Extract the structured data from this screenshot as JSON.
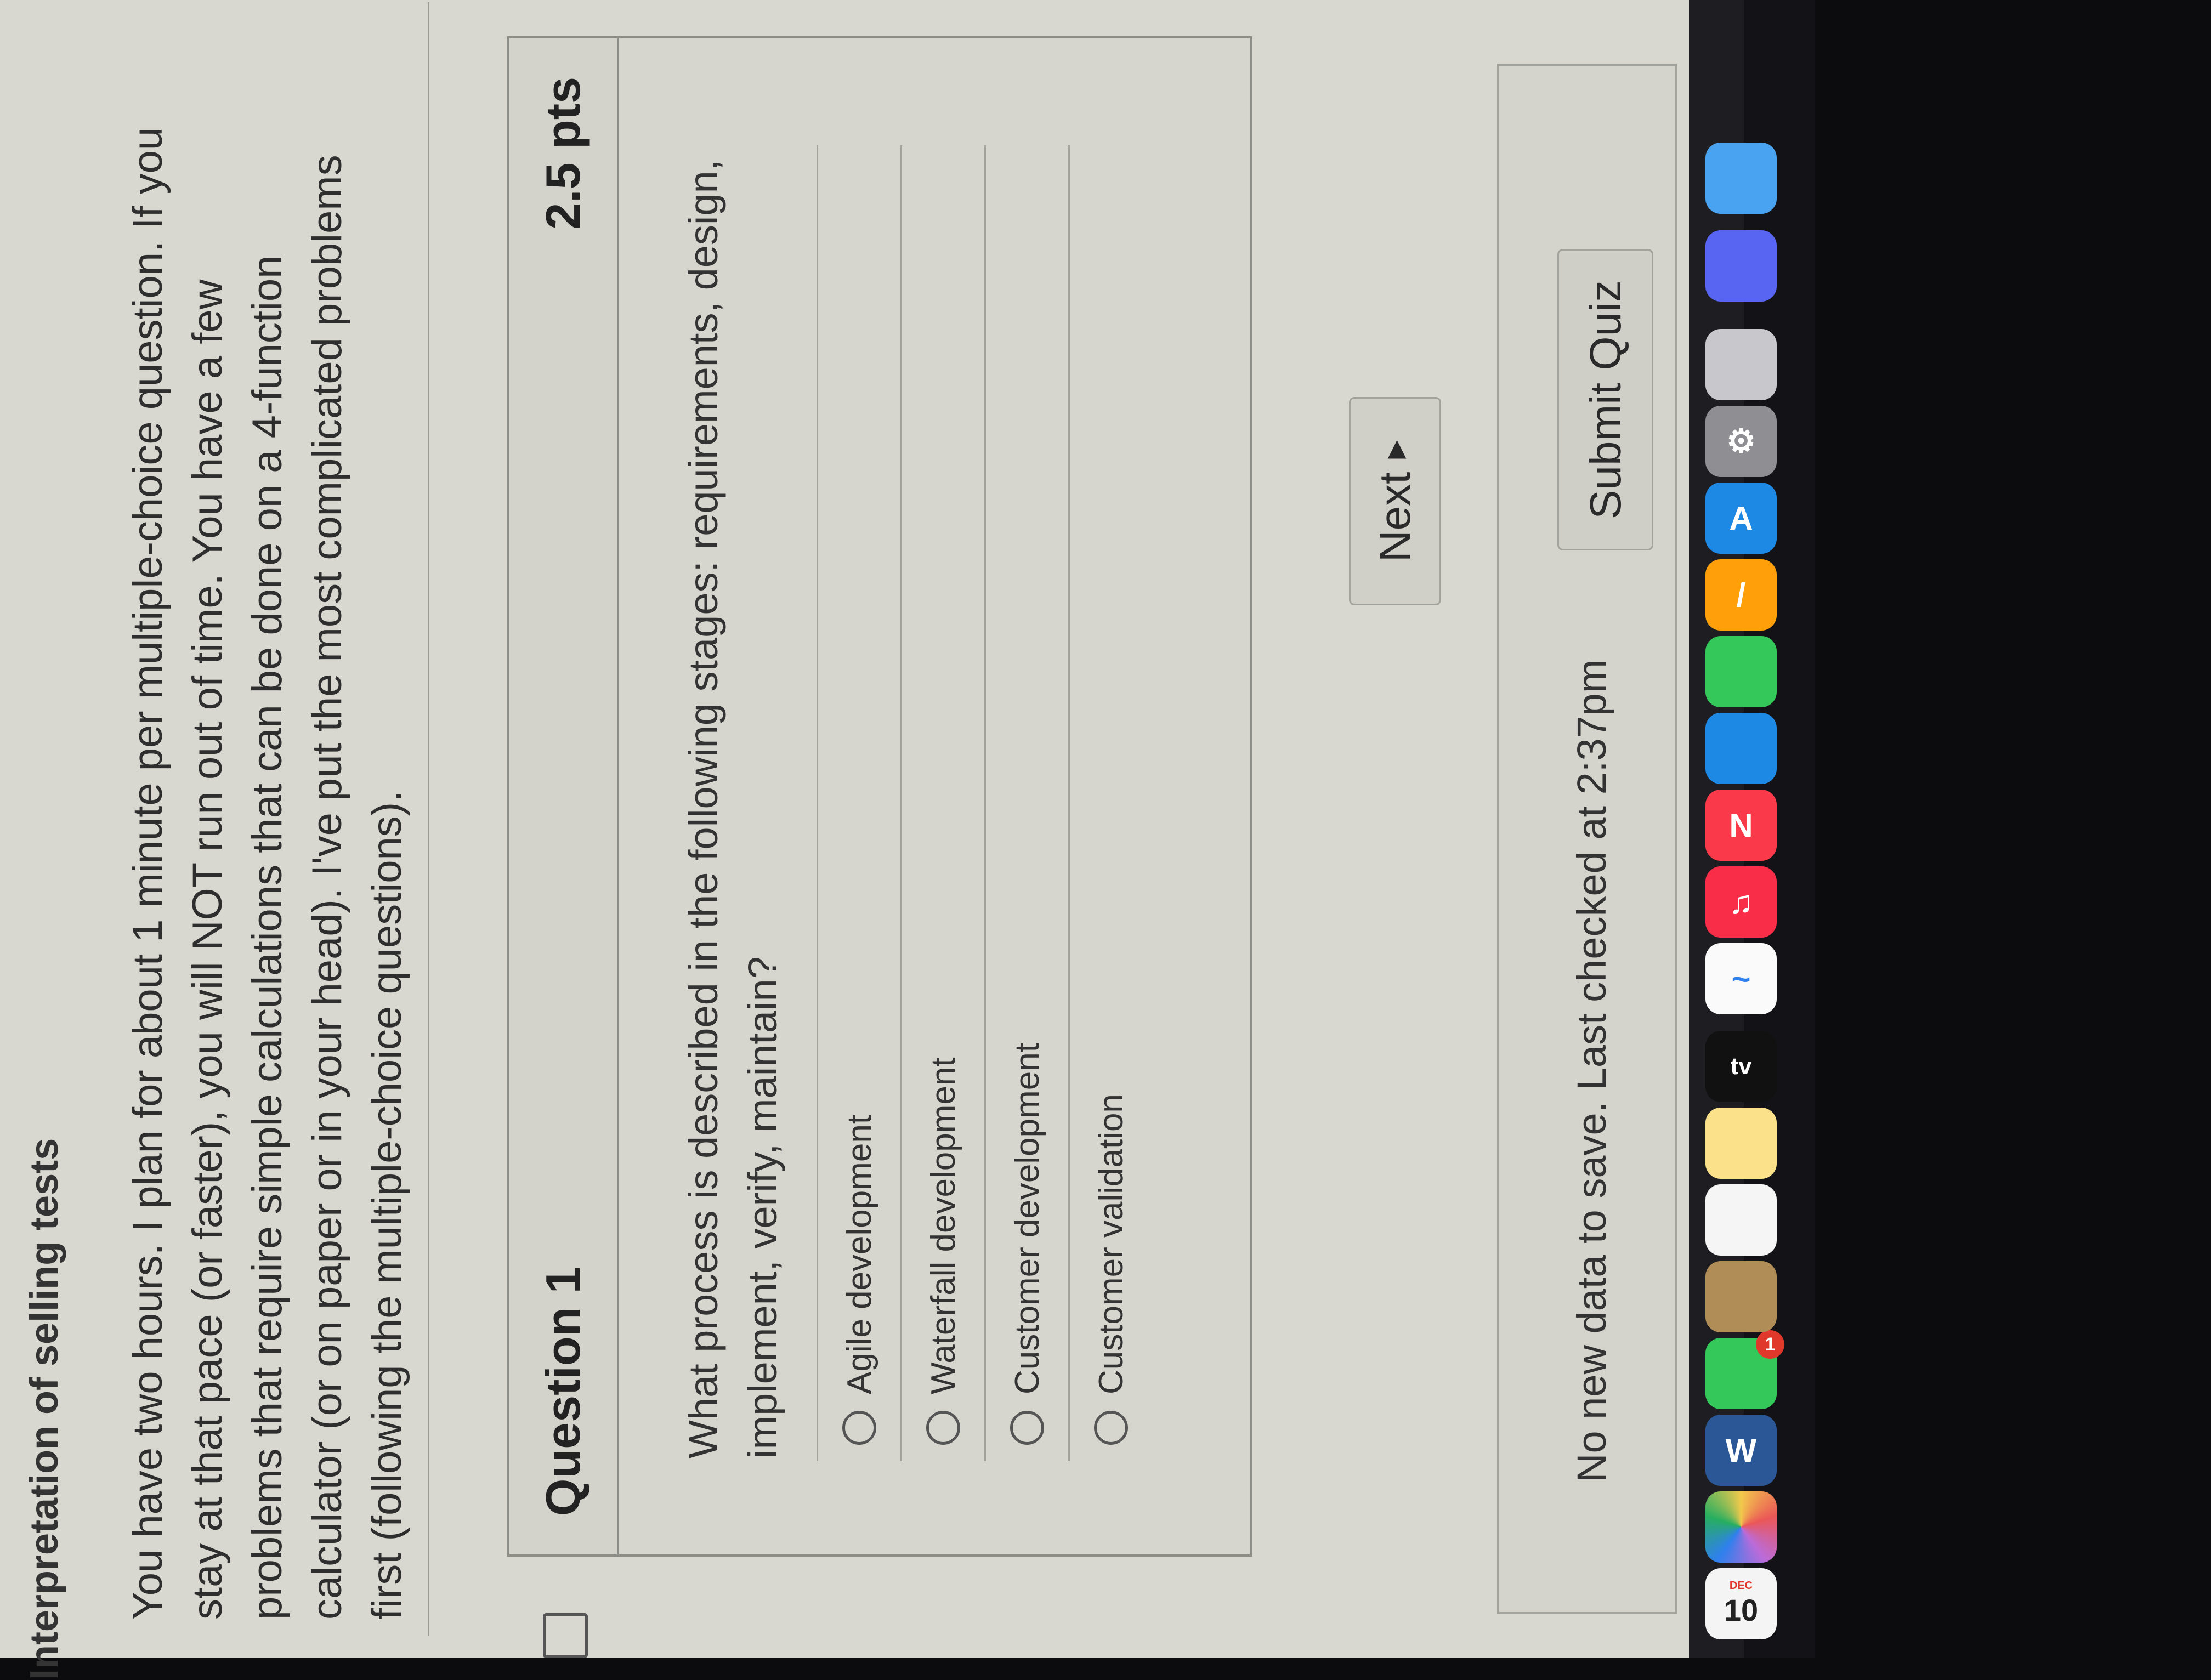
{
  "page": {
    "heading": "Interpretation of selling tests",
    "intro": "You have two hours. I plan for about 1 minute per multiple-choice question. If you stay at that pace (or faster), you will NOT run out of time. You have a few problems that require simple calculations that can be done on a 4-function calculator (or on paper or in your head). I've put the most complicated problems first (following the multiple-choice questions)."
  },
  "question": {
    "title": "Question 1",
    "points": "2.5 pts",
    "text": "What process is described in the following stages: requirements, design, implement, verify, maintain?",
    "options": [
      "Agile development",
      "Waterfall development",
      "Customer development",
      "Customer validation"
    ]
  },
  "nav": {
    "next_label": "Next",
    "next_icon": "triangle-right"
  },
  "footer": {
    "save_status": "No new data to save. Last checked at 2:37pm",
    "submit_label": "Submit Quiz"
  },
  "dock": {
    "calendar_month": "DEC",
    "calendar_day": "10",
    "messages_badge": "1",
    "tv_label": "tv",
    "icons": [
      "calendar-icon",
      "photos-icon",
      "word-icon",
      "messages-icon",
      "contacts-icon",
      "reminders-icon",
      "notes-icon",
      "apple-tv-icon",
      "freeform-icon",
      "music-icon",
      "news-icon",
      "keynote-icon",
      "numbers-icon",
      "pages-icon",
      "app-store-icon",
      "system-settings-icon",
      "iphone-mirroring-icon",
      "discord-icon",
      "finder-globe-icon"
    ]
  }
}
